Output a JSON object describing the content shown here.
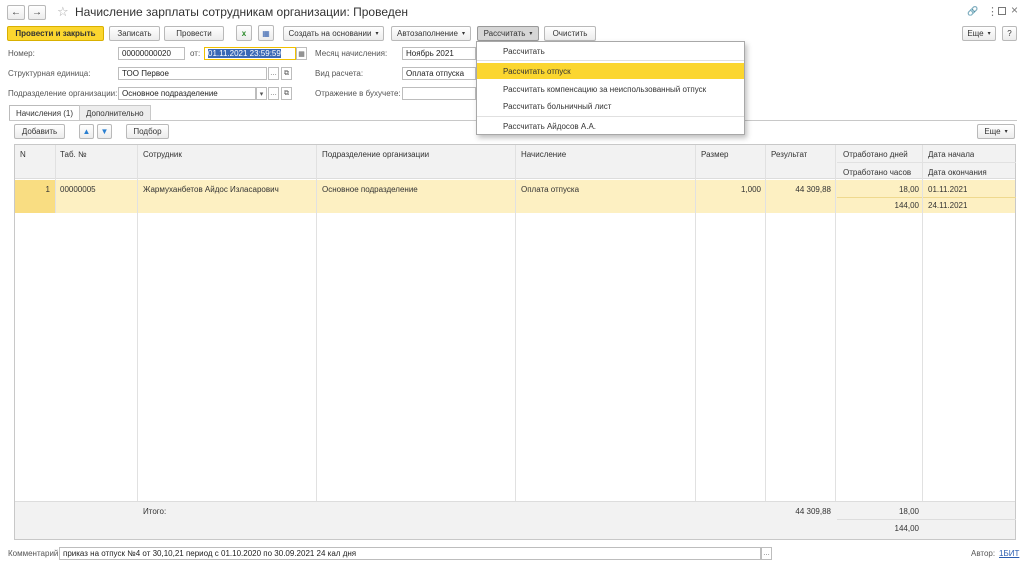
{
  "window": {
    "title": "Начисление зарплаты сотрудникам организации: Проведен",
    "more_menu": "⋮",
    "close": "×"
  },
  "toolbar": {
    "post_close": "Провести и закрыть",
    "save": "Записать",
    "post": "Провести",
    "create_based": "Создать на основании",
    "autofill": "Автозаполнение",
    "calculate": "Рассчитать",
    "clear": "Очистить",
    "more": "Еще",
    "help": "?"
  },
  "calc_menu": {
    "items": [
      "Рассчитать",
      "Рассчитать отпуск",
      "Рассчитать компенсацию за неиспользованный отпуск",
      "Рассчитать больничный лист",
      "Рассчитать Айдосов А.А."
    ]
  },
  "form": {
    "number_label": "Номер:",
    "number_value": "00000000020",
    "date_label": "от:",
    "date_value": "01.11.2021 23:59:59",
    "month_label": "Месяц начисления:",
    "month_value": "Ноябрь 2021",
    "unit_label": "Структурная единица:",
    "unit_value": "ТОО Первое",
    "calc_type_label": "Вид расчета:",
    "calc_type_value": "Оплата отпуска",
    "dept_label": "Подразделение организации:",
    "dept_value": "Основное подразделение",
    "accounting_label": "Отражение в бухучете:",
    "accounting_value": ""
  },
  "tabs": [
    "Начисления (1)",
    "Дополнительно"
  ],
  "table_toolbar": {
    "add": "Добавить",
    "pick": "Подбор",
    "more": "Еще"
  },
  "table": {
    "headers": {
      "n": "N",
      "tab": "Таб. №",
      "employee": "Сотрудник",
      "dept": "Подразделение организации",
      "accrual": "Начисление",
      "size": "Размер",
      "result": "Результат",
      "days_worked": "Отработано дней",
      "hours_worked": "Отработано часов",
      "start_date": "Дата начала",
      "end_date": "Дата окончания"
    },
    "row": {
      "n": "1",
      "tab": "00000005",
      "employee": "Жармуханбетов Айдос Изласарович",
      "dept": "Основное подразделение",
      "accrual": "Оплата отпуска",
      "size": "1,000",
      "result": "44 309,88",
      "days": "18,00",
      "hours": "144,00",
      "start": "01.11.2021",
      "end": "24.11.2021"
    },
    "footer": {
      "label": "Итого:",
      "result": "44 309,88",
      "days": "18,00",
      "hours": "144,00"
    }
  },
  "bottom": {
    "comment_label": "Комментарий:",
    "comment_value": "приказ на отпуск №4 от 30,10,21 период с 01.10.2020 по 30.09.2021   24 кал дня",
    "author_label": "Автор:",
    "author_value": "1БИТ"
  }
}
